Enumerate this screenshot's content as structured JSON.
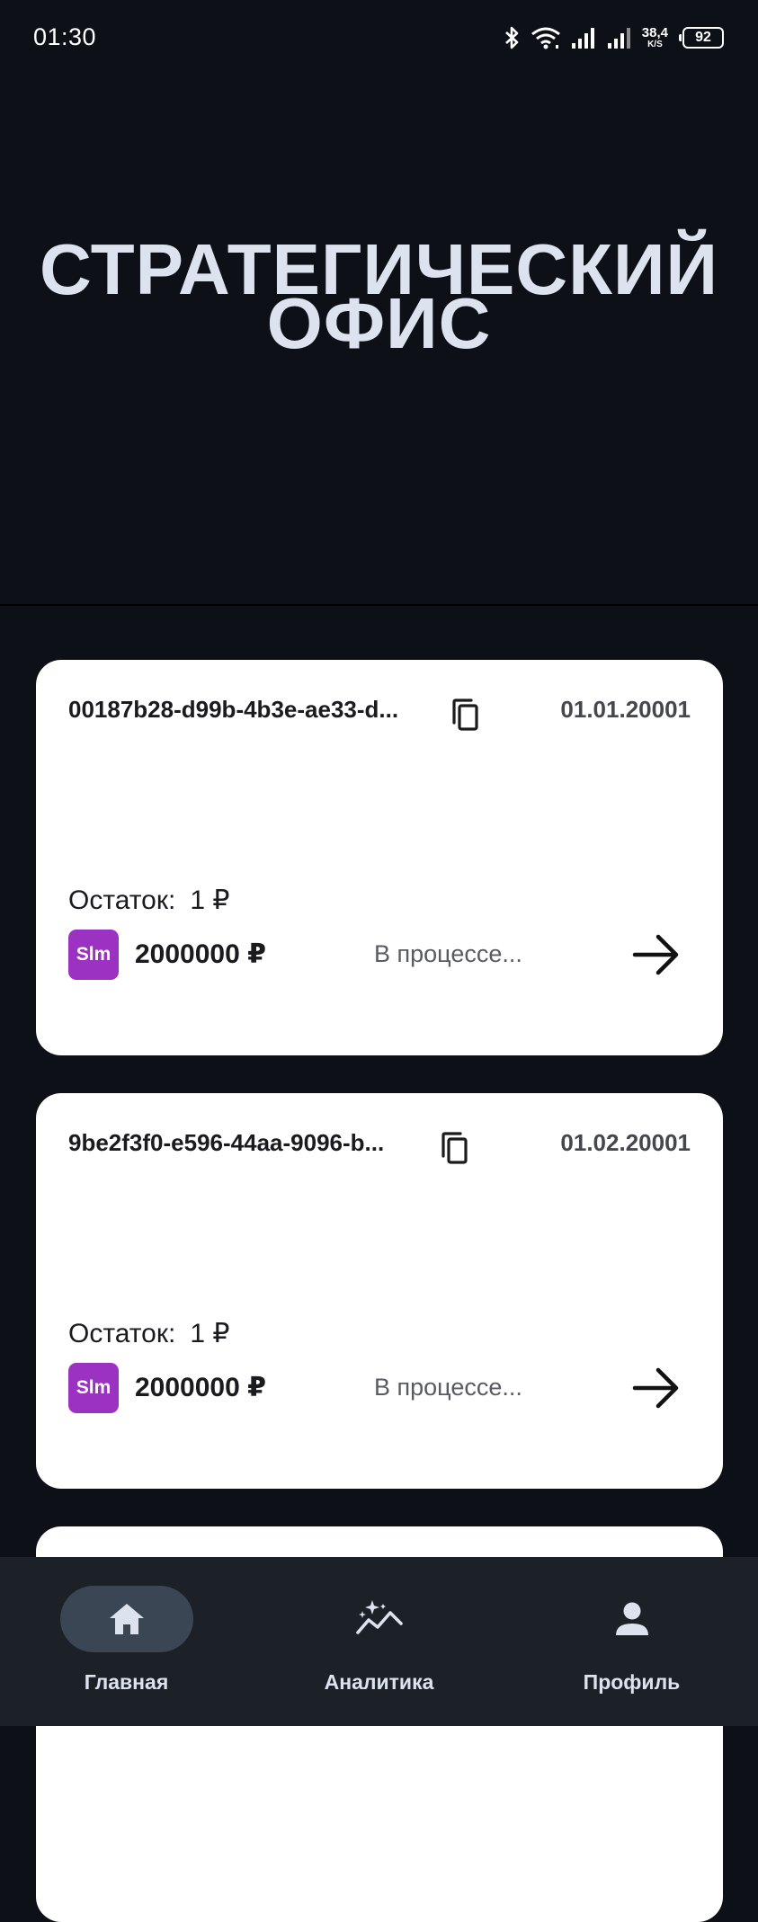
{
  "status_bar": {
    "time": "01:30",
    "net_speed": "38,4",
    "net_unit": "K/S",
    "battery": "92",
    "icons": [
      "bluetooth-icon",
      "wifi-icon",
      "signal-icon",
      "signal-icon",
      "battery-icon"
    ]
  },
  "hero": {
    "line1": "СТРАТЕГИЧЕСКИЙ",
    "line2": "ОФИС"
  },
  "cards": [
    {
      "id": "00187b28-d99b-4b3e-ae33-d...",
      "date": "01.01.20001",
      "balance_label": "Остаток:",
      "balance_value": "1 ₽",
      "badge": "Slm",
      "amount": "2000000 ₽",
      "status": "В процессе..."
    },
    {
      "id": "9be2f3f0-e596-44aa-9096-b...",
      "date": "01.02.20001",
      "balance_label": "Остаток:",
      "balance_value": "1 ₽",
      "badge": "Slm",
      "amount": "2000000 ₽",
      "status": "В процессе..."
    }
  ],
  "nav": {
    "items": [
      {
        "label": "Главная",
        "icon": "home-icon",
        "active": true
      },
      {
        "label": "Аналитика",
        "icon": "analytics-icon",
        "active": false
      },
      {
        "label": "Профиль",
        "icon": "profile-icon",
        "active": false
      }
    ]
  },
  "colors": {
    "background": "#0d1117",
    "nav_background": "#1c2128",
    "badge": "#9b32c2",
    "active_pill": "#3a4654"
  }
}
